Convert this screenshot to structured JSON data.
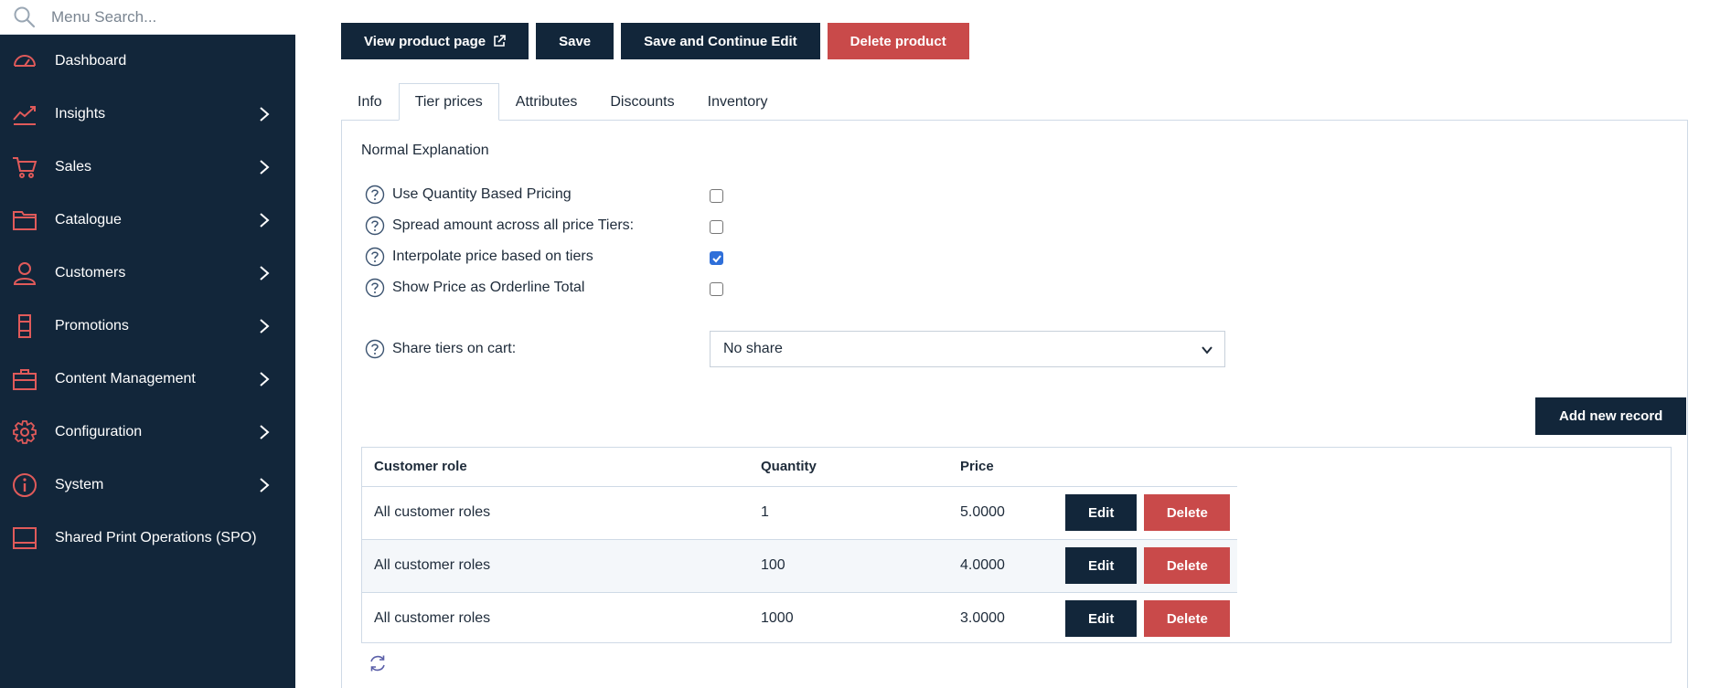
{
  "sidebar": {
    "search_placeholder": "Menu Search...",
    "items": [
      {
        "label": "Dashboard",
        "icon": "gauge-icon",
        "has_children": false
      },
      {
        "label": "Insights",
        "icon": "chart-line-icon",
        "has_children": true
      },
      {
        "label": "Sales",
        "icon": "cart-icon",
        "has_children": true
      },
      {
        "label": "Catalogue",
        "icon": "folder-icon",
        "has_children": true
      },
      {
        "label": "Customers",
        "icon": "user-icon",
        "has_children": true
      },
      {
        "label": "Promotions",
        "icon": "tag-icon",
        "has_children": true
      },
      {
        "label": "Content Management",
        "icon": "briefcase-icon",
        "has_children": true
      },
      {
        "label": "Configuration",
        "icon": "gear-icon",
        "has_children": true
      },
      {
        "label": "System",
        "icon": "info-icon",
        "has_children": true
      },
      {
        "label": "Shared Print Operations (SPO)",
        "icon": "monitor-icon",
        "has_children": false
      }
    ]
  },
  "toolbar": {
    "view_product_label": "View product page",
    "save_label": "Save",
    "save_continue_label": "Save and Continue Edit",
    "delete_label": "Delete product"
  },
  "tabs": [
    {
      "label": "Info",
      "active": false
    },
    {
      "label": "Tier prices",
      "active": true
    },
    {
      "label": "Attributes",
      "active": false
    },
    {
      "label": "Discounts",
      "active": false
    },
    {
      "label": "Inventory",
      "active": false
    }
  ],
  "panel": {
    "explanation": "Normal Explanation",
    "options": [
      {
        "label": "Use Quantity Based Pricing",
        "checked": false
      },
      {
        "label": "Spread amount across all price Tiers:",
        "checked": false
      },
      {
        "label": "Interpolate price based on tiers",
        "checked": true
      },
      {
        "label": "Show Price as Orderline Total",
        "checked": false
      }
    ],
    "share_tiers": {
      "label": "Share tiers on cart:",
      "value": "No share"
    },
    "add_record_label": "Add new record"
  },
  "grid": {
    "columns": [
      "Customer role",
      "Quantity",
      "Price"
    ],
    "rows": [
      {
        "role": "All customer roles",
        "quantity": "1",
        "price": "5.0000"
      },
      {
        "role": "All customer roles",
        "quantity": "100",
        "price": "4.0000"
      },
      {
        "role": "All customer roles",
        "quantity": "1000",
        "price": "3.0000"
      }
    ],
    "edit_label": "Edit",
    "delete_label": "Delete"
  },
  "colors": {
    "sidebar_bg": "#12263a",
    "accent_red": "#c94a4a",
    "icon_red": "#e05a5a",
    "checkbox_blue": "#2f6fd9"
  }
}
